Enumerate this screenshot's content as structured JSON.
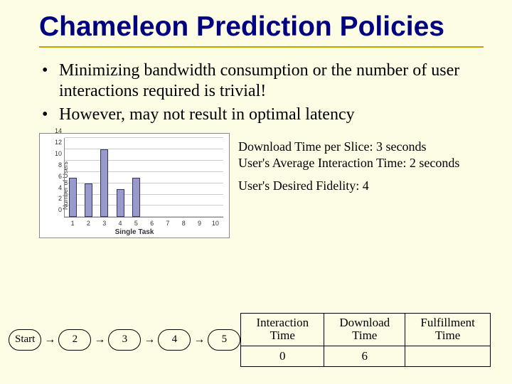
{
  "title": "Chameleon Prediction Policies",
  "bullets": [
    "Minimizing bandwidth consumption or the number of user interactions required is trivial!",
    "However, may not result in optimal latency"
  ],
  "chart_data": {
    "type": "bar",
    "categories": [
      "1",
      "2",
      "3",
      "4",
      "5",
      "6",
      "7",
      "8",
      "9",
      "10"
    ],
    "values": [
      7,
      6,
      12,
      5,
      7,
      0,
      0,
      0,
      0,
      0
    ],
    "ylabel": "Number of Users",
    "xlabel": "Single Task",
    "ylim": [
      0,
      14
    ],
    "ytick_step": 2
  },
  "info": {
    "line1": "Download Time per Slice: 3 seconds",
    "line2": "User's Average Interaction Time: 2 seconds",
    "line3": "User's Desired Fidelity: 4"
  },
  "flow": [
    "Start",
    "2",
    "3",
    "4",
    "5"
  ],
  "table": {
    "headers": [
      "Interaction Time",
      "Download Time",
      "Fulfillment Time"
    ],
    "row": [
      "0",
      "6",
      ""
    ]
  }
}
